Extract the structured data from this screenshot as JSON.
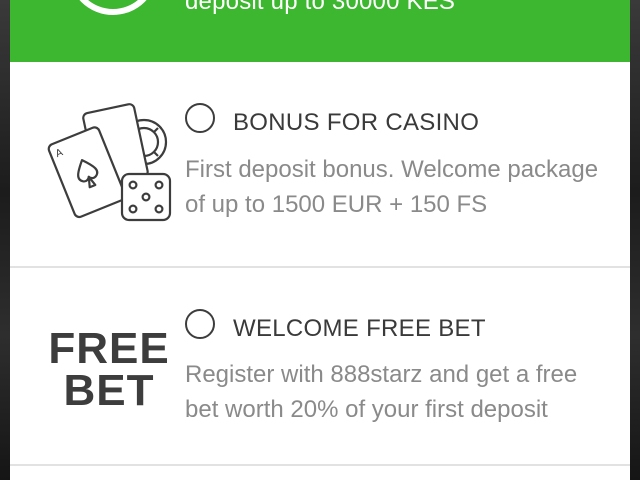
{
  "header": {
    "title": "deposit up to 30000 KES",
    "icon": "globe-icon"
  },
  "options": [
    {
      "title": "BONUS FOR CASINO",
      "description": "First deposit bonus. Welcome package of up to 1500 EUR + 150 FS",
      "icon": "casino-cards-dice-icon",
      "selected": false
    },
    {
      "title": "WELCOME FREE BET",
      "description": "Register with 888starz and get a free bet worth 20% of your first deposit",
      "logo_line1": "FREE",
      "logo_line2": "BET",
      "selected": false
    }
  ],
  "colors": {
    "accent_green": "#3cb72f",
    "title_text": "#3a3a3a",
    "description_text": "#8a8a8a"
  }
}
